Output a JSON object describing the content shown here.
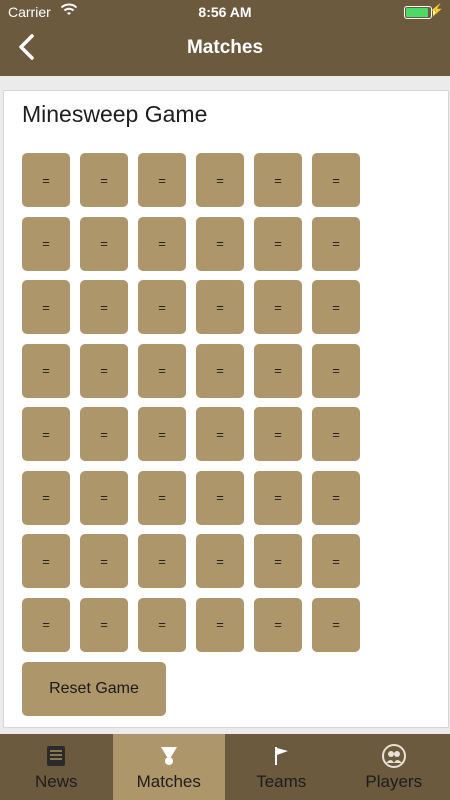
{
  "status_bar": {
    "carrier": "Carrier",
    "time": "8:56 AM"
  },
  "nav": {
    "title": "Matches",
    "back_icon": "chevron-left-icon"
  },
  "card": {
    "title": "Minesweep Game",
    "grid": [
      [
        "=",
        "=",
        "=",
        "=",
        "=",
        "="
      ],
      [
        "=",
        "=",
        "=",
        "=",
        "=",
        "="
      ],
      [
        "=",
        "=",
        "=",
        "=",
        "=",
        "="
      ],
      [
        "=",
        "=",
        "=",
        "=",
        "=",
        "="
      ],
      [
        "=",
        "=",
        "=",
        "=",
        "=",
        "="
      ],
      [
        "=",
        "=",
        "=",
        "=",
        "=",
        "="
      ],
      [
        "=",
        "=",
        "=",
        "=",
        "=",
        "="
      ],
      [
        "=",
        "=",
        "=",
        "=",
        "=",
        "="
      ]
    ],
    "reset_label": "Reset Game"
  },
  "tabs": [
    {
      "label": "News",
      "icon": "newspaper-icon",
      "active": false
    },
    {
      "label": "Matches",
      "icon": "trophy-icon",
      "active": true
    },
    {
      "label": "Teams",
      "icon": "flag-icon",
      "active": false
    },
    {
      "label": "Players",
      "icon": "users-icon",
      "active": false
    }
  ],
  "colors": {
    "bar": "#6b5a3e",
    "tile": "#ad9669",
    "card": "#ffffff",
    "battery": "#4cd964"
  }
}
